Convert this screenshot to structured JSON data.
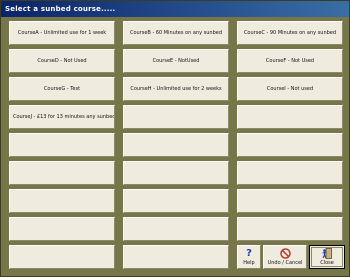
{
  "window": {
    "title": "Select a sunbed course....."
  },
  "courses": [
    "CourseA - Unlimited use for 1 week",
    "CourseB - 60 Minutes on any sunbed",
    "CourseC - 90 Minutes on any sunbed",
    "CourseD - Not Used",
    "CourseE - NotUsed",
    "CourseF - Not Used",
    "CourseG - Test",
    "CourseH - Unlimited use for 2 weeks",
    "CourseI - Not used",
    "CourseJ - £13 for 13 minutes any sunbeds89"
  ],
  "toolbar": {
    "help_label": "Help",
    "undo_label": "Undo / Cancel",
    "close_label": "Close"
  },
  "icons": {
    "help": "question-mark-icon",
    "undo": "no-entry-icon",
    "close": "door-exit-icon"
  },
  "colors": {
    "window_bg": "#767649",
    "button_face": "#efebde",
    "title_start": "#0a246a",
    "title_end": "#3a6ea5",
    "undo_icon": "#c0392b",
    "help_icon": "#1f3fae"
  }
}
